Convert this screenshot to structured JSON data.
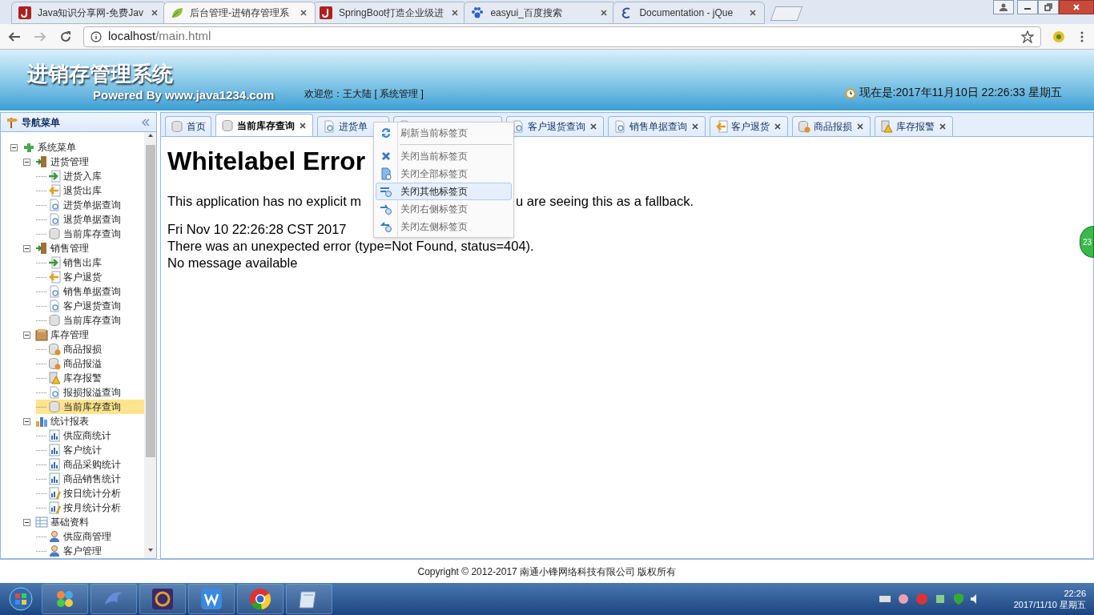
{
  "browser": {
    "tabs": [
      {
        "title": "Java知识分享网-免费Jav",
        "kind": "j",
        "selected": false
      },
      {
        "title": "后台管理-进销存管理系",
        "kind": "leaf",
        "selected": true
      },
      {
        "title": "SpringBoot打造企业级进",
        "kind": "j",
        "selected": false
      },
      {
        "title": "easyui_百度搜索",
        "kind": "paw",
        "selected": false
      },
      {
        "title": "Documentation - jQue",
        "kind": "e",
        "selected": false
      }
    ],
    "url_host": "localhost",
    "url_path": "/main.html"
  },
  "header": {
    "title": "进销存管理系统",
    "subtitle": "Powered By www.java1234.com",
    "welcome": "欢迎您：王大陆 [ 系统管理 ]",
    "clock": "现在是:2017年11月10日 22:26:33 星期五"
  },
  "sidebar": {
    "title": "导航菜单",
    "tree": [
      {
        "label": "系统菜单",
        "kind": "puzzle",
        "expanded": true,
        "selected": false,
        "children": [
          {
            "label": "进货管理",
            "kind": "door",
            "expanded": true,
            "selected": false,
            "children": [
              {
                "label": "进货入库",
                "kind": "in",
                "selected": false
              },
              {
                "label": "退货出库",
                "kind": "out",
                "selected": false
              },
              {
                "label": "进货单据查询",
                "kind": "query",
                "selected": false
              },
              {
                "label": "退货单据查询",
                "kind": "query",
                "selected": false
              },
              {
                "label": "当前库存查询",
                "kind": "db",
                "selected": false
              }
            ]
          },
          {
            "label": "销售管理",
            "kind": "door",
            "expanded": true,
            "selected": false,
            "children": [
              {
                "label": "销售出库",
                "kind": "in",
                "selected": false
              },
              {
                "label": "客户退货",
                "kind": "out",
                "selected": false
              },
              {
                "label": "销售单据查询",
                "kind": "query",
                "selected": false
              },
              {
                "label": "客户退货查询",
                "kind": "query",
                "selected": false
              },
              {
                "label": "当前库存查询",
                "kind": "db",
                "selected": false
              }
            ]
          },
          {
            "label": "库存管理",
            "kind": "box",
            "expanded": true,
            "selected": false,
            "children": [
              {
                "label": "商品报损",
                "kind": "loss",
                "selected": false
              },
              {
                "label": "商品报溢",
                "kind": "loss",
                "selected": false
              },
              {
                "label": "库存报警",
                "kind": "alarm",
                "selected": false
              },
              {
                "label": "报损报溢查询",
                "kind": "query",
                "selected": false
              },
              {
                "label": "当前库存查询",
                "kind": "db",
                "selected": true
              }
            ]
          },
          {
            "label": "统计报表",
            "kind": "bars",
            "expanded": true,
            "selected": false,
            "children": [
              {
                "label": "供应商统计",
                "kind": "bar",
                "selected": false
              },
              {
                "label": "客户统计",
                "kind": "bar",
                "selected": false
              },
              {
                "label": "商品采购统计",
                "kind": "bar",
                "selected": false
              },
              {
                "label": "商品销售统计",
                "kind": "bar",
                "selected": false
              },
              {
                "label": "按日统计分析",
                "kind": "analysis",
                "selected": false
              },
              {
                "label": "按月统计分析",
                "kind": "analysis",
                "selected": false
              }
            ]
          },
          {
            "label": "基础资料",
            "kind": "grid",
            "expanded": true,
            "selected": false,
            "children": [
              {
                "label": "供应商管理",
                "kind": "person",
                "selected": false
              },
              {
                "label": "客户管理",
                "kind": "person",
                "selected": false
              }
            ]
          }
        ]
      }
    ]
  },
  "content": {
    "tabs": [
      {
        "label": "首页",
        "kind": "db",
        "closable": false,
        "selected": false
      },
      {
        "label": "当前库存查询",
        "kind": "db",
        "closable": true,
        "selected": true
      },
      {
        "label": "进货单",
        "kind": "query",
        "selected": false
      },
      {
        "kind": "query",
        "selected": false
      },
      {
        "label": "客户退货查询",
        "kind": "query",
        "closable": true,
        "selected": false
      },
      {
        "label": "销售单据查询",
        "kind": "query",
        "closable": true,
        "selected": false
      },
      {
        "label": "客户退货",
        "kind": "out",
        "closable": true,
        "selected": false
      },
      {
        "label": "商品报损",
        "kind": "loss",
        "closable": true,
        "selected": false
      },
      {
        "label": "库存报警",
        "kind": "alarm",
        "closable": true,
        "selected": false
      }
    ],
    "page": {
      "heading": "Whitelabel Error",
      "paragraph_parts": [
        "This application has no explicit m",
        "u are seeing this as a fallback."
      ],
      "lines": [
        "Fri Nov 10 22:26:28 CST 2017",
        "There was an unexpected error (type=Not Found, status=404).",
        "No message available"
      ]
    }
  },
  "context_menu": [
    {
      "label": "刷新当前标签页",
      "kind": "refresh",
      "highlighted": false
    },
    {
      "label": "关闭当前标签页",
      "kind": "close",
      "highlighted": false
    },
    {
      "label": "关闭全部标签页",
      "kind": "close_all",
      "highlighted": false
    },
    {
      "label": "关闭其他标签页",
      "kind": "close_other",
      "highlighted": true
    },
    {
      "label": "关闭右侧标签页",
      "kind": "close_right",
      "highlighted": false
    },
    {
      "label": "关闭左侧标签页",
      "kind": "close_left",
      "highlighted": false
    }
  ],
  "floating_badge": "23",
  "footer": "Copyright © 2012-2017 南通小锋网络科技有限公司 版权所有",
  "taskbar": {
    "apps": [
      {
        "kind": "pinwheel"
      },
      {
        "kind": "dolphin"
      },
      {
        "kind": "ide"
      },
      {
        "kind": "wps"
      },
      {
        "kind": "chrome"
      },
      {
        "kind": "notepad"
      }
    ],
    "time": "22:26",
    "date": "2017/11/10 星期五"
  }
}
